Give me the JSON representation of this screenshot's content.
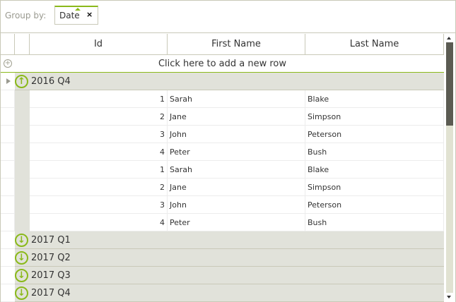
{
  "group_panel": {
    "label": "Group by:",
    "chip": "Date",
    "close": "×"
  },
  "columns": [
    "Id",
    "First Name",
    "Last Name"
  ],
  "new_row": "Click here to add a new row",
  "groups": [
    {
      "title": "2016 Q4",
      "expanded": true,
      "rows": [
        {
          "id": "1",
          "first": "Sarah",
          "last": "Blake"
        },
        {
          "id": "2",
          "first": "Jane",
          "last": "Simpson"
        },
        {
          "id": "3",
          "first": "John",
          "last": "Peterson"
        },
        {
          "id": "4",
          "first": "Peter",
          "last": "Bush"
        },
        {
          "id": "1",
          "first": "Sarah",
          "last": "Blake"
        },
        {
          "id": "2",
          "first": "Jane",
          "last": "Simpson"
        },
        {
          "id": "3",
          "first": "John",
          "last": "Peterson"
        },
        {
          "id": "4",
          "first": "Peter",
          "last": "Bush"
        }
      ]
    },
    {
      "title": "2017 Q1",
      "expanded": false
    },
    {
      "title": "2017 Q2",
      "expanded": false
    },
    {
      "title": "2017 Q3",
      "expanded": false
    },
    {
      "title": "2017 Q4",
      "expanded": false
    }
  ],
  "colors": {
    "accent": "#8ab91a",
    "group_bg": "#e1e2da"
  }
}
